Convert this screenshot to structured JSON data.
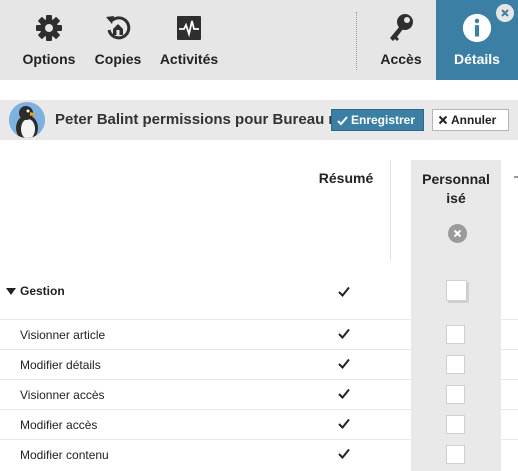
{
  "toolbar": {
    "options_label": "Options",
    "copies_label": "Copies",
    "activites_label": "Activités",
    "acces_label": "Accès",
    "details_label": "Détails"
  },
  "header": {
    "title": "Peter Balint permissions pour Bureau m",
    "save_label": "Enregistrer",
    "cancel_label": "Annuler"
  },
  "columns": {
    "resume": "Résumé",
    "custom_line1": "Personnal",
    "custom_line2": "isé"
  },
  "permissions": {
    "group": {
      "label": "Gestion",
      "summary_checked": true,
      "custom_checked": false
    },
    "items": [
      {
        "label": "Visionner article",
        "summary_checked": true,
        "custom_checked": false
      },
      {
        "label": "Modifier détails",
        "summary_checked": true,
        "custom_checked": false
      },
      {
        "label": "Visionner accès",
        "summary_checked": true,
        "custom_checked": false
      },
      {
        "label": "Modifier accès",
        "summary_checked": true,
        "custom_checked": false
      },
      {
        "label": "Modifier contenu",
        "summary_checked": true,
        "custom_checked": false
      }
    ]
  },
  "colors": {
    "accent": "#3b7fa4",
    "toolbar_bg": "#e6e6e6",
    "panel_bg": "#e9e9e9"
  },
  "icons": {
    "options": "gear-icon",
    "copies": "copies-refresh-icon",
    "activites": "activity-chart-icon",
    "acces": "key-icon",
    "details": "info-icon",
    "close": "close-icon",
    "save": "check-icon",
    "cancel": "x-icon",
    "clear": "clear-circle-icon",
    "group": "caret-down-icon",
    "check": "check-icon"
  }
}
